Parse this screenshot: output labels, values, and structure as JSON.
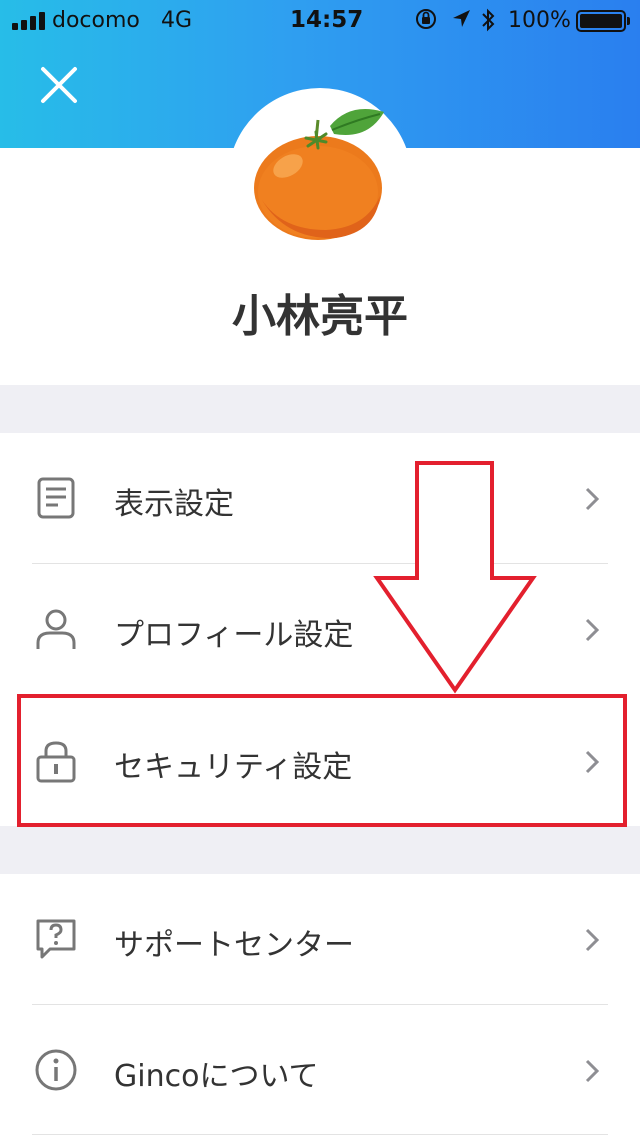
{
  "status_bar": {
    "carrier": "docomo",
    "network": "4G",
    "time": "14:57",
    "battery": "100%",
    "icons": [
      "signal-icon",
      "orientation-lock-icon",
      "location-icon",
      "bluetooth-icon",
      "battery-icon"
    ]
  },
  "header": {
    "close_icon": "close-icon",
    "avatar": "orange-fruit-image",
    "user_name": "小林亮平",
    "gradient_colors": [
      "#27bde8",
      "#2a7fef"
    ]
  },
  "menu": {
    "items": [
      {
        "label": "表示設定",
        "icon": "document-icon"
      },
      {
        "label": "プロフィール設定",
        "icon": "person-icon"
      },
      {
        "label": "セキュリティ設定",
        "icon": "lock-icon",
        "highlighted": true
      },
      {
        "label": "サポートセンター",
        "icon": "help-bubble-icon"
      },
      {
        "label": "Gincoについて",
        "icon": "info-icon"
      }
    ]
  },
  "annotation": {
    "color": "#e3202e"
  }
}
